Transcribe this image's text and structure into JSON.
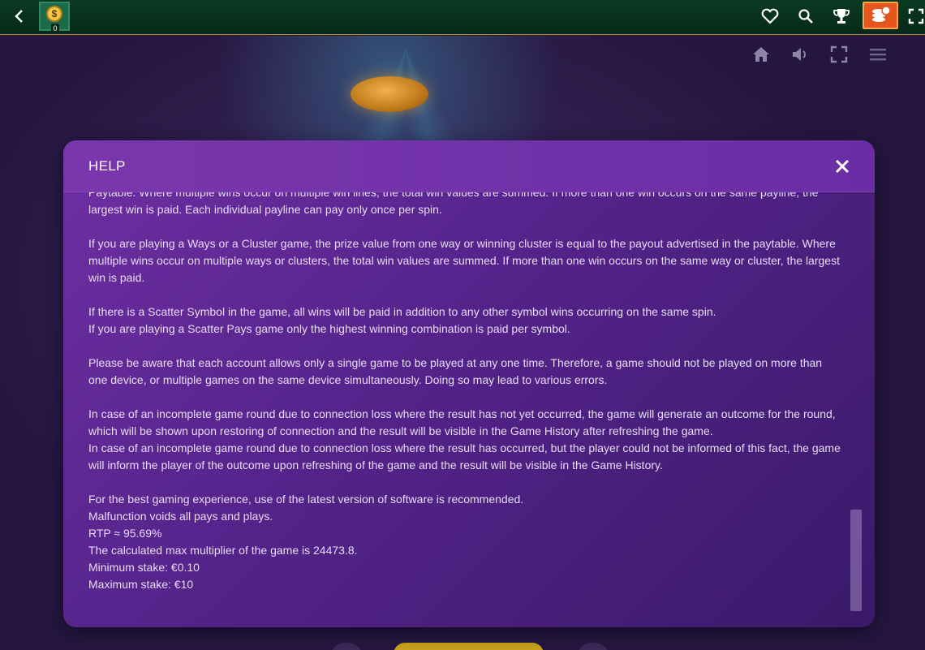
{
  "topbar": {
    "wallet_count": "0",
    "wallet_symbol": "$",
    "icons": [
      "back-icon",
      "heart-icon",
      "search-icon",
      "trophy-icon",
      "cashier-icon",
      "fullscreen-icon"
    ],
    "accent": "#e5561f"
  },
  "game": {
    "controls": [
      "home-icon",
      "sound-icon",
      "expand-icon",
      "menu-icon"
    ]
  },
  "help": {
    "title": "HELP",
    "paragraphs": [
      [
        "Paytable. Where multiple wins occur on multiple win lines, the total win values are summed. If more than one win occurs on the same payline, the largest win is paid. Each individual payline can pay only once per spin."
      ],
      [
        "If you are playing a Ways or a Cluster game, the prize value from one way or winning cluster is equal to the payout advertised in the paytable. Where multiple wins occur on multiple ways or clusters, the total win values are summed. If more than one win occurs on the same way or cluster, the largest win is paid."
      ],
      [
        "If there is a Scatter Symbol in the game, all wins will be paid in addition to any other symbol wins occurring on the same spin.",
        "If you are playing a Scatter Pays game only the highest winning combination is paid per symbol."
      ],
      [
        "Please be aware that each account allows only a single game to be played at any one time. Therefore, a game should not be played on more than one device, or multiple games on the same device simultaneously. Doing so may lead to various errors."
      ],
      [
        "In case of an incomplete game round due to connection loss where the result has not yet occurred, the game will generate an outcome for the round, which will be shown upon restoring of connection and the result will be visible in the Game History after refreshing the game.",
        "In case of an incomplete game round due to connection loss where the result has occurred, but the player could not be informed of this fact, the game will inform the player of the outcome upon refreshing of the game and the result will be visible in the Game History."
      ],
      [
        "For the best gaming experience, use of the latest version of software is recommended.",
        "Malfunction voids all pays and plays.",
        "RTP ≈ 95.69%",
        "The calculated max multiplier of the game is 24473.8.",
        "Minimum stake: €0.10",
        "Maximum stake: €10"
      ]
    ]
  },
  "colors": {
    "modal_header": "#7a37ad",
    "modal_bg": "#54238a",
    "topbar_bg": "#0a3a24",
    "text": "#e6dcf2"
  }
}
